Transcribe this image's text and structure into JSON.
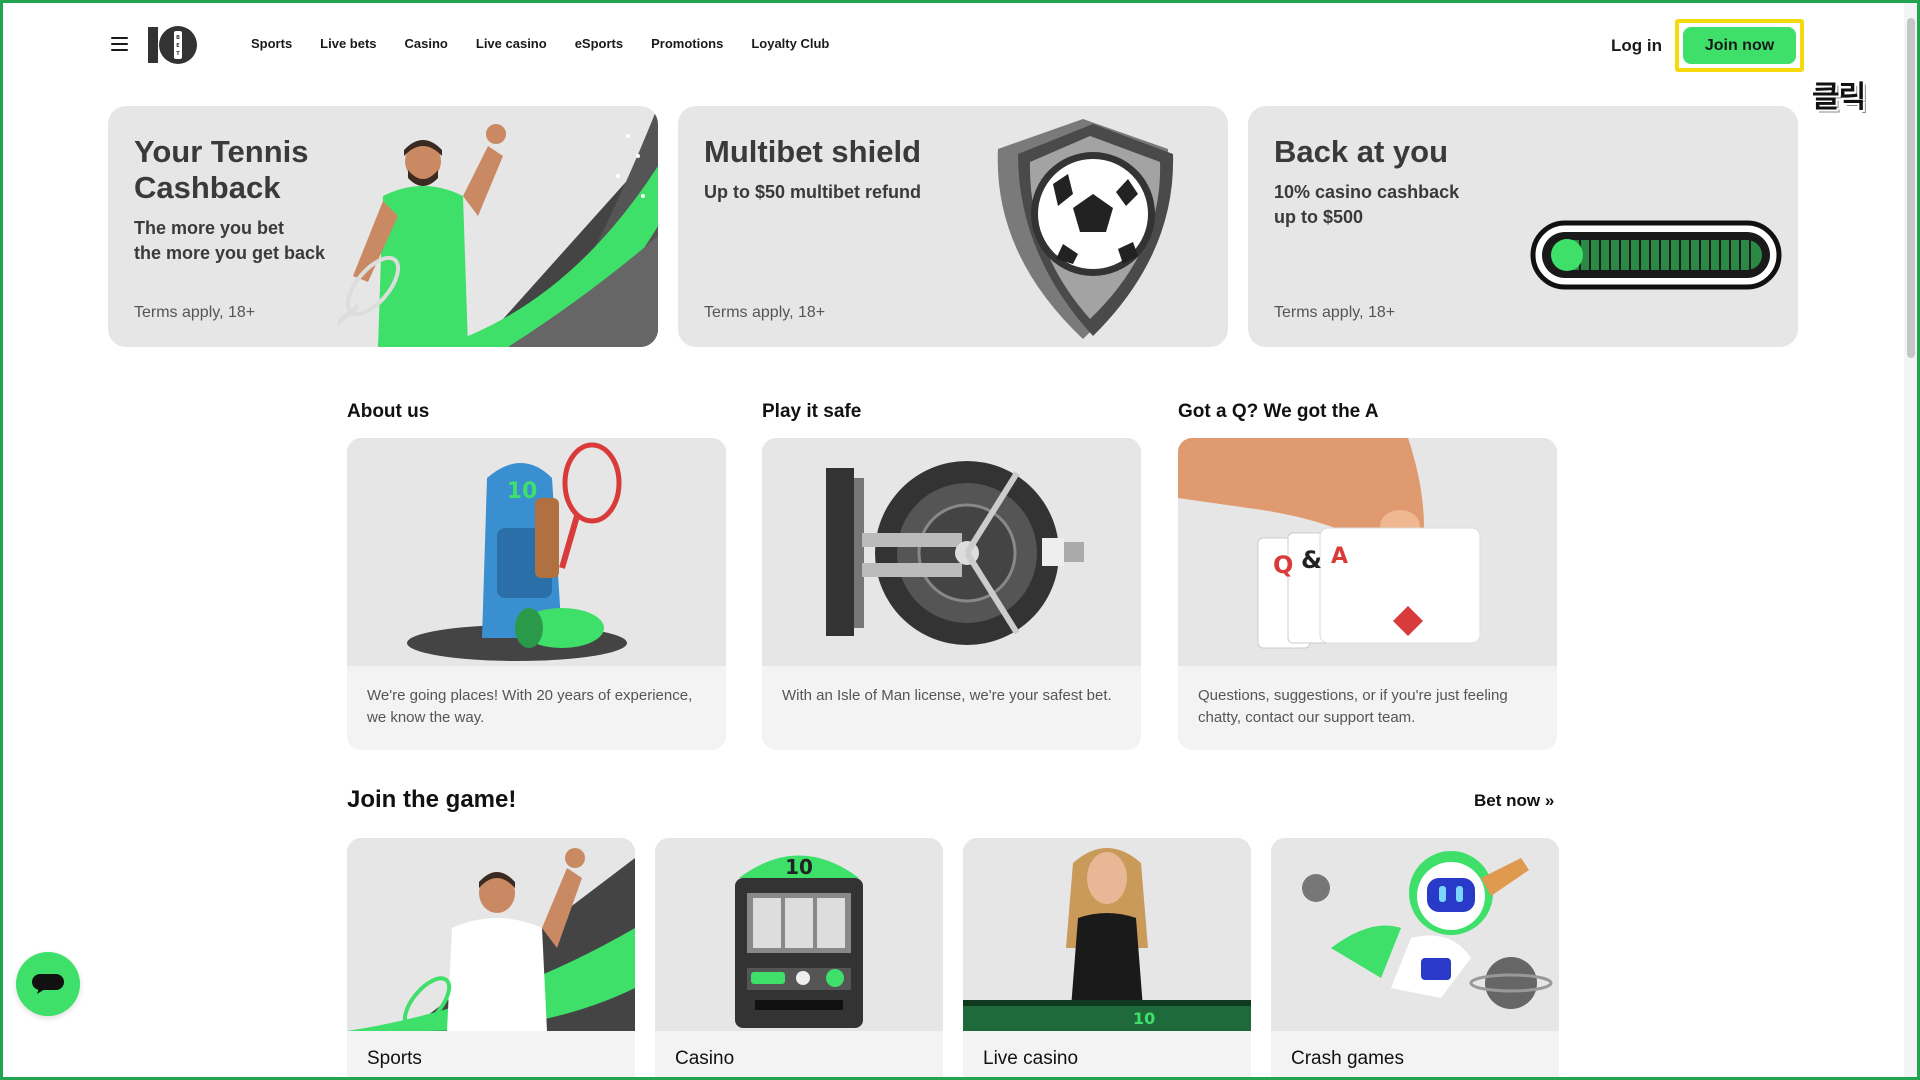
{
  "header": {
    "nav": [
      "Sports",
      "Live bets",
      "Casino",
      "Live casino",
      "eSports",
      "Promotions",
      "Loyalty Club"
    ],
    "login": "Log in",
    "join": "Join now",
    "click_overlay": "클릭"
  },
  "promos": [
    {
      "title_line1": "Your Tennis",
      "title_line2": "Cashback",
      "sub_line1": "The more you bet",
      "sub_line2": "the more you get back",
      "terms": "Terms apply, 18+"
    },
    {
      "title_line1": "Multibet shield",
      "sub_line1": "Up to $50 multibet refund",
      "terms": "Terms apply, 18+"
    },
    {
      "title_line1": "Back at you",
      "sub_line1": "10% casino cashback",
      "sub_line2": "up to $500",
      "terms": "Terms apply, 18+"
    }
  ],
  "info": [
    {
      "title": "About us",
      "desc": "We're going places! With 20 years of experience, we know the way."
    },
    {
      "title": "Play it safe",
      "desc": "With an Isle of Man license, we're your safest bet."
    },
    {
      "title": "Got a Q? We got the A",
      "desc": "Questions, suggestions, or if you're just feeling chatty, contact our support team."
    }
  ],
  "games": {
    "title": "Join the game!",
    "bet_now": "Bet now",
    "items": [
      "Sports",
      "Casino",
      "Live casino",
      "Crash games"
    ]
  },
  "colors": {
    "accent": "#3ee06a",
    "highlight": "#f5d90a",
    "card_bg": "#e6e6e6",
    "frame": "#22a34f"
  }
}
